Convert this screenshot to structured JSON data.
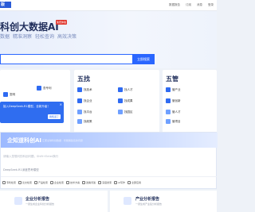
{
  "nav": {
    "logo_fragment": "版",
    "links": [
      "数据报告",
      "订阅",
      "消息",
      "登录"
    ]
  },
  "hero": {
    "brand": "科创大数据AI",
    "badge": "免费体验",
    "slogans": [
      "数据",
      "精准洞察",
      "轻松查询",
      "高效决策"
    ],
    "search_placeholder": "",
    "search_button": "立即搜索"
  },
  "cards": {
    "a": {
      "title": "",
      "items": [
        {
          "label": "发明",
          "icon": "patent-icon"
        },
        {
          "label": "查专利",
          "icon": "search-patent-icon"
        }
      ]
    },
    "b": {
      "title": "五找",
      "items": [
        {
          "label": "找技术",
          "icon": "tech-icon"
        },
        {
          "label": "找人才",
          "icon": "talent-icon"
        },
        {
          "label": "找企业",
          "icon": "company-icon"
        },
        {
          "label": "找成果",
          "icon": "result-icon"
        },
        {
          "label": "找平台",
          "icon": "platform-icon"
        },
        {
          "label": "找园区",
          "icon": "park-icon"
        },
        {
          "label": "找政策",
          "icon": "policy-icon"
        }
      ]
    },
    "c": {
      "title": "五管",
      "items": [
        {
          "label": "管产业",
          "icon": "industry-icon"
        },
        {
          "label": "管创新",
          "icon": "innovation-icon"
        },
        {
          "label": "管人才",
          "icon": "manage-talent-icon"
        },
        {
          "label": "管项目",
          "icon": "project-icon"
        }
      ]
    }
  },
  "popup": {
    "text": "接入DeepSeek-R1模型，全新升级！",
    "button": "我知道了",
    "close": "×"
  },
  "ai": {
    "title": "企知道科创AI",
    "subtitle": "汇聚全球科创数据 · 智能解答您的问题",
    "input_placeholder": "请输入您想问的科创问题，Shift+Enter换行",
    "model_label": "DeepSeek-R1深度思考模型",
    "tools": [
      "专利检索",
      "论文检索",
      "产品检索",
      "企业检索",
      "技术方案",
      "政策问答",
      "深度搜索",
      "AI写作",
      "全部应用"
    ]
  },
  "bottom": {
    "a": {
      "title": "企业分析报告",
      "sub": "一键生成企业科创分析报告"
    },
    "b": {
      "title": "产业分析报告",
      "sub": "一键生成产业链分析报告"
    }
  },
  "colors": {
    "accent": "#2a66ff",
    "title_text": "#1f2d5a",
    "popup_bg": "#2f6df0",
    "badge_red": "#e0342b"
  }
}
